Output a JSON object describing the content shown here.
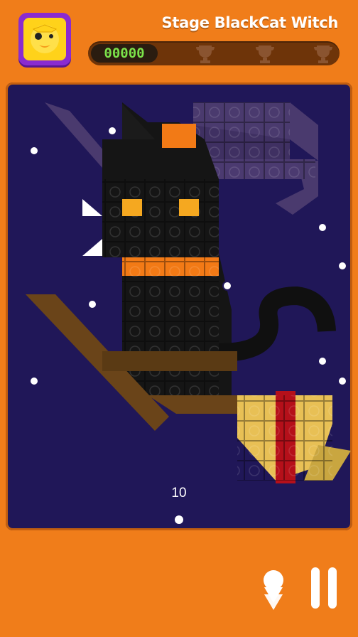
{
  "header": {
    "stage_title": "Stage BlackCat Witch",
    "score": "00000",
    "trophies": [
      "trophy-1",
      "trophy-2",
      "trophy-3"
    ],
    "avatar_icon": "duck-face-icon"
  },
  "board": {
    "ball_count": "10",
    "colors": {
      "background": "#201758",
      "cat": "#151515",
      "hat": "#4b3a70",
      "eyes": "#f5a820",
      "collar": "#f27a16",
      "broom_handle": "#6a4419",
      "broom_bristle": "#e8c055",
      "broom_band": "#b5101a"
    }
  },
  "controls": {
    "down_icon": "arrow-down-icon",
    "pause_icon": "pause-icon"
  }
}
